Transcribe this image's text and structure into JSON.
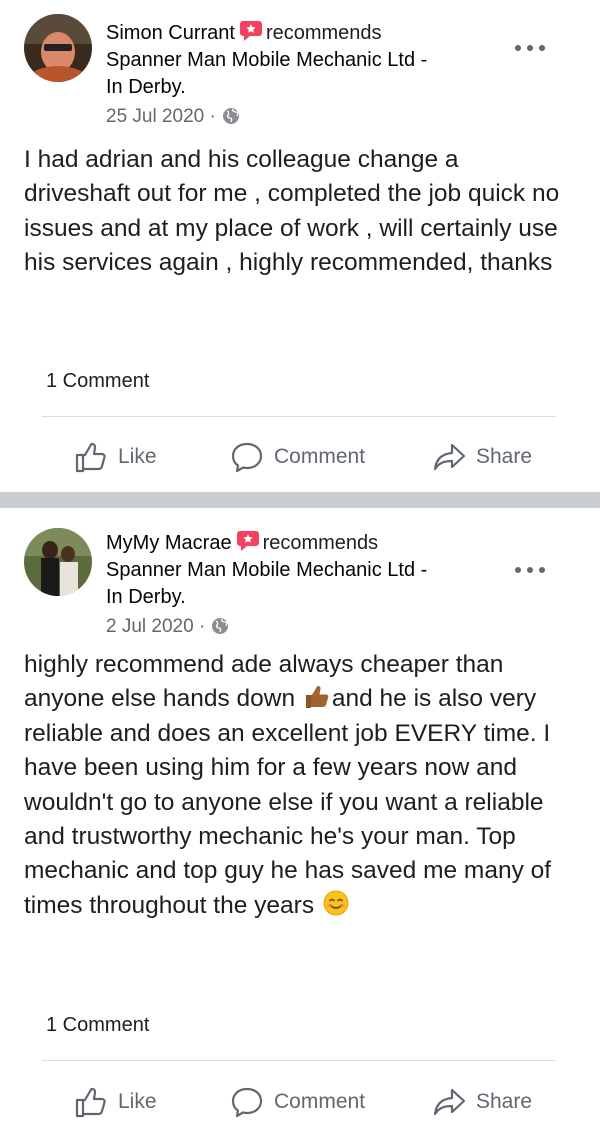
{
  "posts": [
    {
      "author": "Simon Currant",
      "recommends": "recommends",
      "page_name": "Spanner Man Mobile Mechanic Ltd -",
      "location": "In Derby.",
      "date": "25 Jul 2020",
      "meta_sep": "·",
      "privacy_icon": "globe-icon",
      "text": "I had adrian and his colleague change a driveshaft out for me , completed the job quick no issues and at my place of work , will certainly use his services again , highly recommended,  thanks",
      "comment_count": "1 Comment",
      "actions": {
        "like": "Like",
        "comment": "Comment",
        "share": "Share"
      }
    },
    {
      "author": "MyMy Macrae",
      "recommends": "recommends",
      "page_name": "Spanner Man Mobile Mechanic Ltd -",
      "location": "In Derby.",
      "date": "2 Jul 2020",
      "meta_sep": "·",
      "privacy_icon": "globe-icon",
      "text_part1": "highly recommend ade always cheaper than anyone else hands down ",
      "text_part2": "and he is also very reliable and does an excellent job EVERY time. I have been using him for a few years now and wouldn't go to anyone else if you want a reliable and trustworthy mechanic he's your man. Top mechanic and top guy he has saved me many of times throughout the years ",
      "emoji_1": "thumbs-up-emoji",
      "emoji_2": "smiling-face-emoji",
      "comment_count": "1 Comment",
      "actions": {
        "like": "Like",
        "comment": "Comment",
        "share": "Share"
      }
    }
  ],
  "colors": {
    "recommend_badge": "#f3425f",
    "secondary_text": "#65676b",
    "action_text": "#606770",
    "separator": "#c9ccd1"
  }
}
